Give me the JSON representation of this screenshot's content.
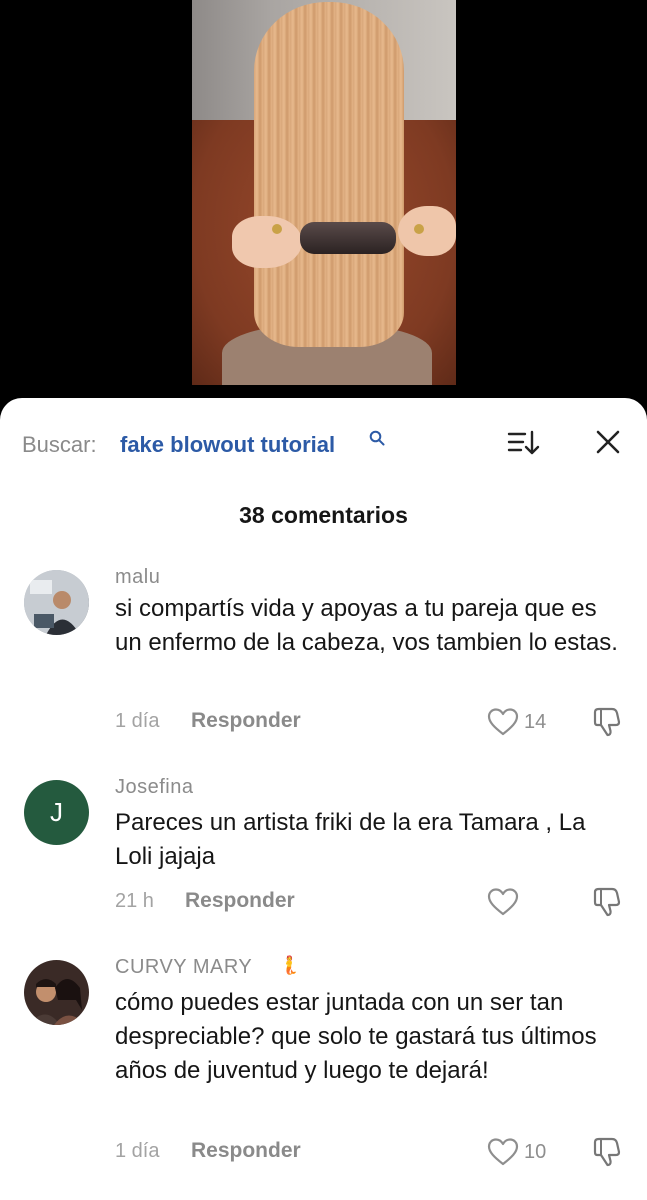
{
  "search": {
    "label": "Buscar:",
    "term": "fake blowout tutorial"
  },
  "comments_count": "38 comentarios",
  "comments": [
    {
      "username": "malu",
      "text": "si compartís vida y apoyas a tu pareja que es un enfermo de la cabeza, vos tambien lo estas.",
      "time": "1 día",
      "reply": "Responder",
      "likes": "14"
    },
    {
      "username": "Josefina",
      "avatar_letter": "J",
      "text": "Pareces un artista friki de la era Tamara , La Loli jajaja",
      "time": "21 h",
      "reply": "Responder",
      "likes": ""
    },
    {
      "username": "CURVY MARY",
      "username_emoji": "🧜",
      "text": "cómo puedes estar juntada con un ser tan despreciable? que solo te gastará tus últimos años de juventud y luego te dejará!",
      "time": "1 día",
      "reply": "Responder",
      "likes": "10"
    }
  ],
  "colors": {
    "search_term": "#2c5aa6",
    "avatar_j": "#245a3e",
    "muted_text": "#8b8b8b"
  }
}
